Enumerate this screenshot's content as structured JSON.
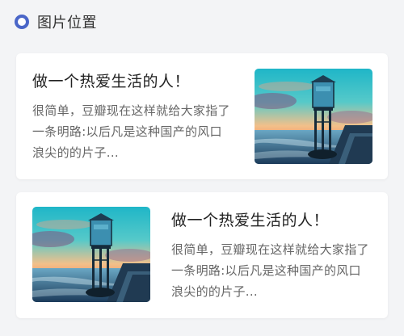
{
  "section": {
    "title": "图片位置",
    "icon": "circle-icon",
    "accent": "#4a66c8"
  },
  "cards": [
    {
      "title": "做一个热爱生活的人！",
      "description": "很简单，豆瓣现在这样就给大家指了一条明路:以后凡是这种国产的风口浪尖的的片子...",
      "image_position": "right"
    },
    {
      "title": "做一个热爱生活的人！",
      "description": "很简单，豆瓣现在这样就给大家指了一条明路:以后凡是这种国产的风口浪尖的的片子...",
      "image_position": "left"
    }
  ]
}
